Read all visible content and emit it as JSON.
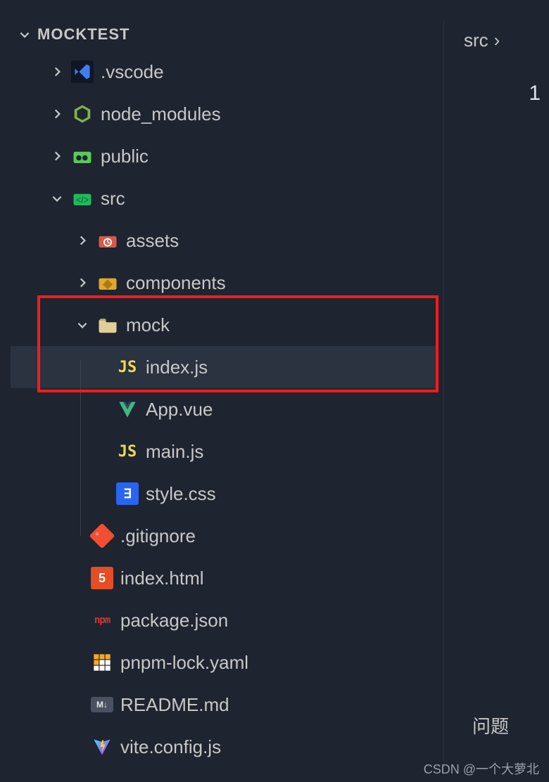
{
  "section_title": "MOCKTEST",
  "breadcrumb": {
    "part1": "src",
    "sep": "›"
  },
  "line_number": "1",
  "problems_label": "问题",
  "watermark": "CSDN @一个大萝北",
  "tree": {
    "vscode": {
      "label": ".vscode"
    },
    "node_modules": {
      "label": "node_modules"
    },
    "public": {
      "label": "public"
    },
    "src": {
      "label": "src"
    },
    "assets": {
      "label": "assets"
    },
    "components": {
      "label": "components"
    },
    "mock": {
      "label": "mock"
    },
    "index_js": {
      "label": "index.js"
    },
    "app_vue": {
      "label": "App.vue"
    },
    "main_js": {
      "label": "main.js"
    },
    "style_css": {
      "label": "style.css"
    },
    "gitignore": {
      "label": ".gitignore"
    },
    "index_html": {
      "label": "index.html"
    },
    "package_json": {
      "label": "package.json"
    },
    "pnpm_lock": {
      "label": "pnpm-lock.yaml"
    },
    "readme_md": {
      "label": "README.md"
    },
    "vite_config": {
      "label": "vite.config.js"
    }
  },
  "icons": {
    "js": "JS",
    "css": "∃",
    "html": "5",
    "npm": "npm",
    "md": "M↓"
  }
}
